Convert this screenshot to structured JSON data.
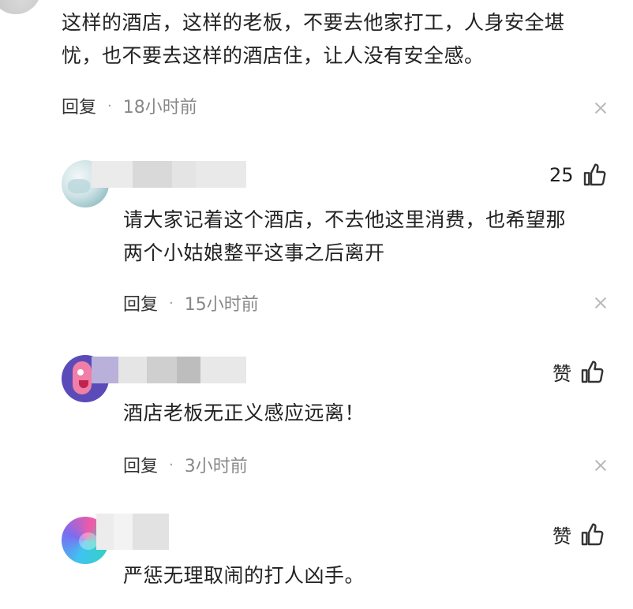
{
  "comments": [
    {
      "text_line1": "这样的酒店，这样的老板，不要去他家打工，人身安全堪",
      "text_line2": "忧，也不要去这样的酒店住，让人没有安全感。",
      "reply_label": "回复",
      "separator": "·",
      "time": "18小时前"
    },
    {
      "likes": "25",
      "text_line1": "请大家记着这个酒店，不去他这里消费，也希望那",
      "text_line2": "两个小姑娘整平这事之后离开",
      "reply_label": "回复",
      "separator": "·",
      "time": "15小时前"
    },
    {
      "likes": "赞",
      "text_line1": "酒店老板无正义感应远离！",
      "reply_label": "回复",
      "separator": "·",
      "time": "3小时前"
    },
    {
      "likes": "赞",
      "text_line1": "严惩无理取闹的打人凶手。"
    }
  ],
  "icons": {
    "like": "thumbs-up-icon",
    "close": "close-icon"
  },
  "colors": {
    "text": "#222222",
    "meta": "#888888",
    "close": "#b8b8b8"
  }
}
